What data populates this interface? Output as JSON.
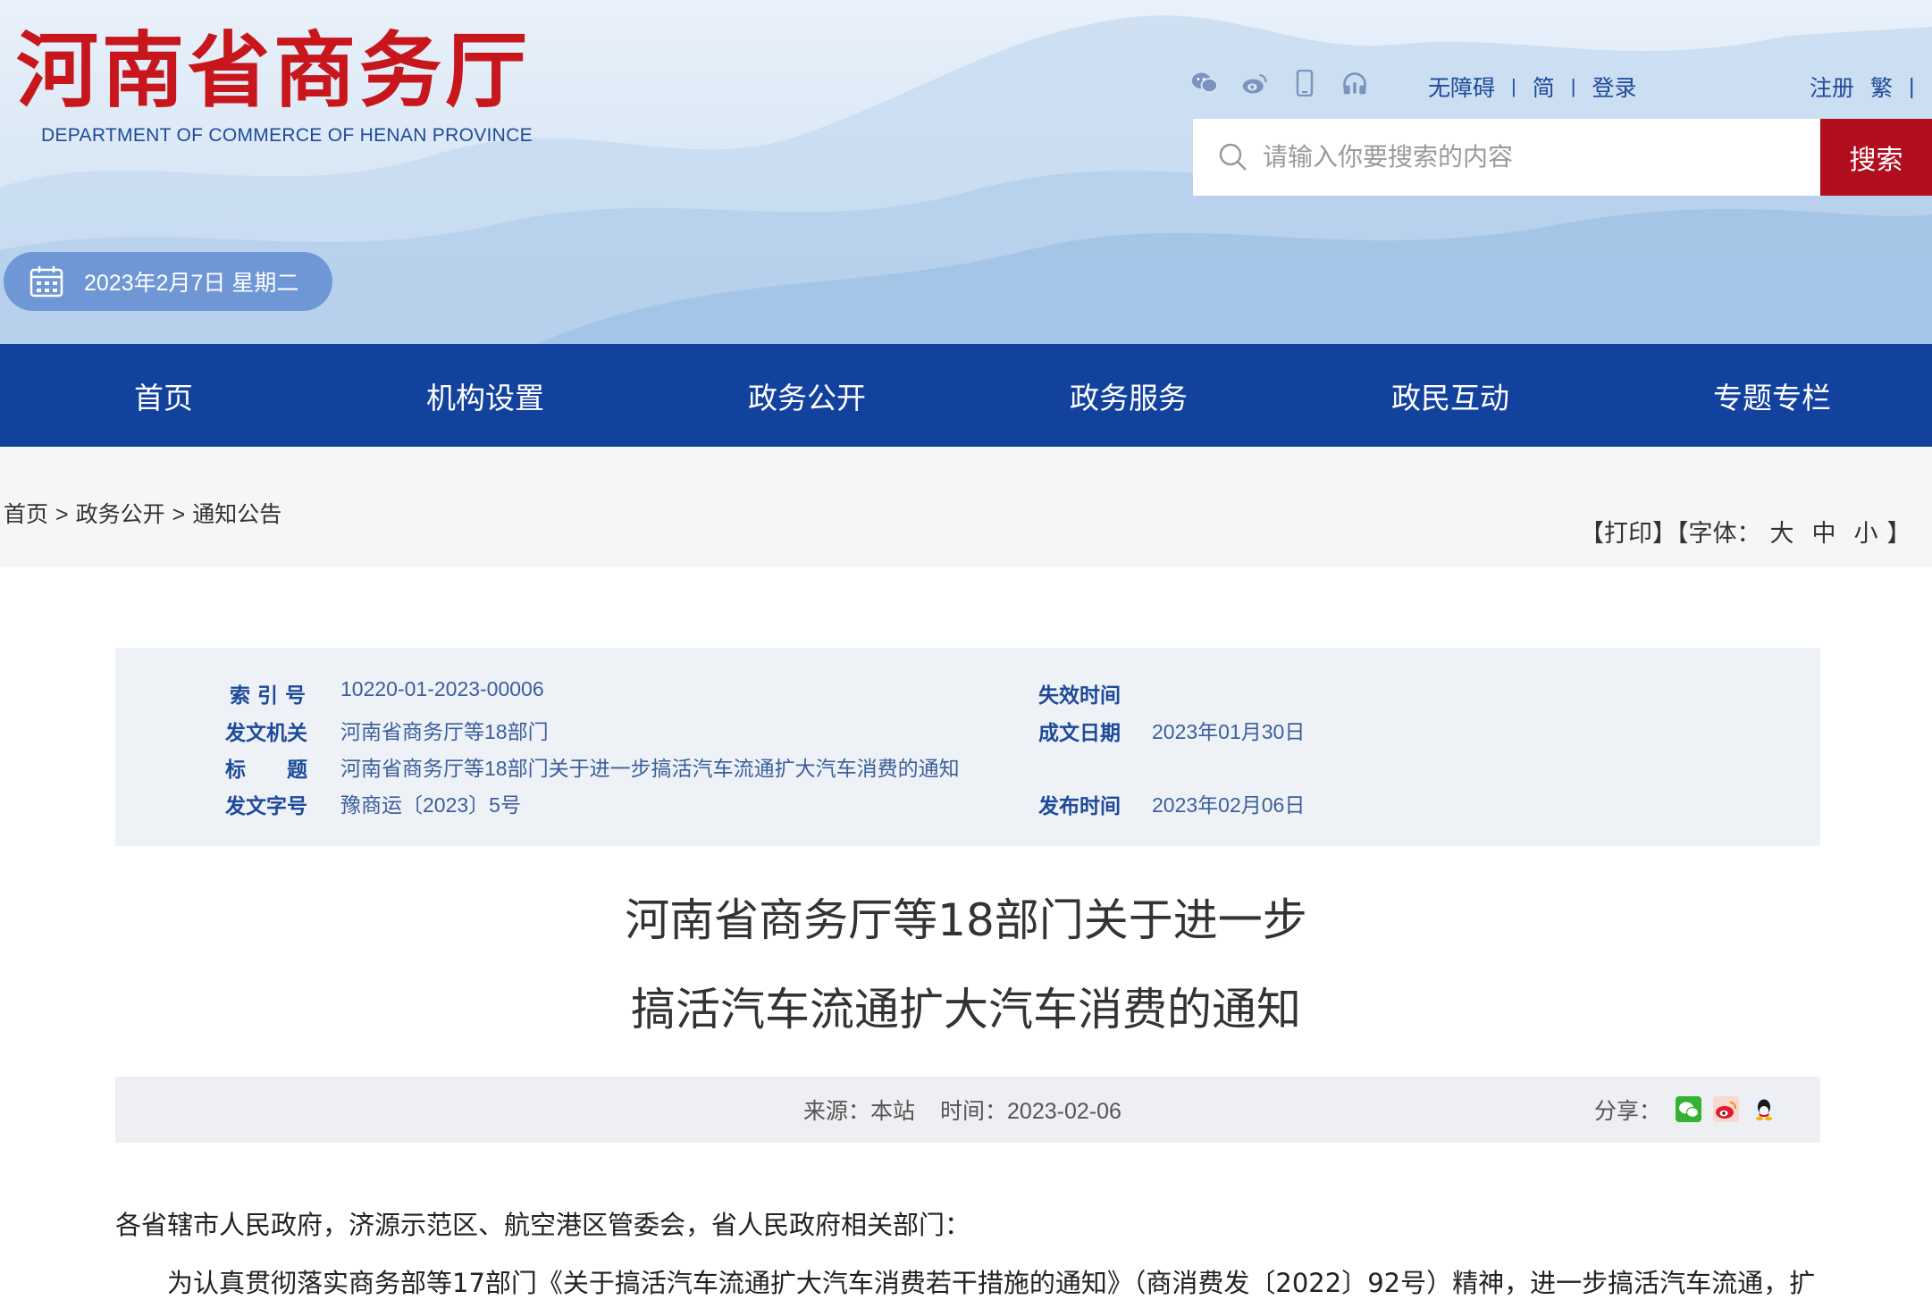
{
  "header": {
    "logo_cn": "河南省商务厅",
    "logo_en": "DEPARTMENT OF COMMERCE OF HENAN PROVINCE",
    "icons": [
      "wechat-icon",
      "weibo-icon",
      "mobile-icon",
      "headphones-icon"
    ],
    "links": {
      "accessibility": "无障碍",
      "simplified": "简",
      "login": "登录",
      "register": "注册",
      "traditional": "繁"
    },
    "separator": "|",
    "search": {
      "placeholder": "请输入你要搜索的内容",
      "button": "搜索"
    },
    "date": "2023年2月7日 星期二"
  },
  "nav": {
    "items": [
      "首页",
      "机构设置",
      "政务公开",
      "政务服务",
      "政民互动",
      "专题专栏"
    ]
  },
  "breadcrumb": {
    "items": [
      "首页",
      "政务公开",
      "通知公告"
    ],
    "separator": ">"
  },
  "tools": {
    "print": "【打印】",
    "font_prefix": "【字体：",
    "large": "大",
    "medium": "中",
    "small": "小",
    "font_suffix": "】"
  },
  "meta": {
    "index_label": "索 引 号",
    "index_value": "10220-01-2023-00006",
    "issuer_label": "发文机关",
    "issuer_value": "河南省商务厅等18部门",
    "title_label": "标　　题",
    "title_value": "河南省商务厅等18部门关于进一步搞活汽车流通扩大汽车消费的通知",
    "docno_label": "发文字号",
    "docno_value": "豫商运〔2023〕5号",
    "expire_label": "失效时间",
    "expire_value": "",
    "written_label": "成文日期",
    "written_value": "2023年01月30日",
    "publish_label": "发布时间",
    "publish_value": "2023年02月06日"
  },
  "article": {
    "title_line1": "河南省商务厅等18部门关于进一步",
    "title_line2": "搞活汽车流通扩大汽车消费的通知",
    "source": "来源：本站",
    "time": "时间：2023-02-06",
    "share_label": "分享：",
    "share_icons": [
      "wechat-share-icon",
      "weibo-share-icon",
      "qq-share-icon"
    ],
    "salutation": "各省辖市人民政府，济源示范区、航空港区管委会，省人民政府相关部门：",
    "para1": "为认真贯彻落实商务部等17部门《关于搞活汽车流通扩大汽车消费若干措施的通知》（商消费发〔2022〕92号）精神，进一步搞活汽车流通，扩"
  },
  "colors": {
    "brand_red": "#c8161d",
    "nav_blue": "#12429d",
    "link_blue": "#1e4a9a",
    "search_red": "#b10e1e"
  }
}
